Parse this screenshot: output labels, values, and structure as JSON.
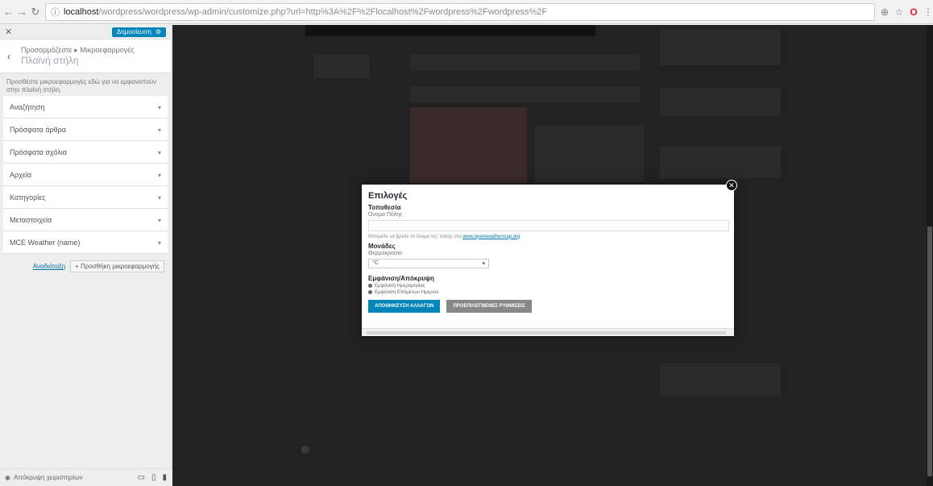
{
  "browser": {
    "url_host": "localhost",
    "url_path": "/wordpress/wordpress/wp-admin/customize.php?url=http%3A%2F%2Flocalhost%2Fwordpress%2Fwordpress%2F"
  },
  "sidebar": {
    "publish_label": "Δημοσίευση",
    "breadcrumb": "Προσαρμόζεστε ▸ Μικροεφαρμογές",
    "title": "Πλαϊνή στήλη",
    "description": "Προσθέστε μικροεφαρμογές εδώ για να εμφανιστούν στην πλαϊνή στήλη.",
    "widgets": [
      {
        "label": "Αναζήτηση"
      },
      {
        "label": "Πρόσφατα άρθρα"
      },
      {
        "label": "Πρόσφατα σχόλια"
      },
      {
        "label": "Αρχεία"
      },
      {
        "label": "Κατηγορίες"
      },
      {
        "label": "Μεταστοιχεία"
      },
      {
        "label": "MCE Weather (name)"
      }
    ],
    "reorder_label": "Αναδιάταξη",
    "add_widget_label": "+ Προσθήκη μικροεφαρμογής",
    "hide_controls_label": "Απόκρυψη χειριστηρίων"
  },
  "modal": {
    "title": "Επιλογές",
    "location_section": "Τοποθεσία",
    "location_field_label": "Όνομα Πόλης",
    "location_value": "",
    "help_text": "Μπορείτε να βρείτε το όνομα της πόλης στο",
    "help_link": "www.openweathermap.org",
    "units_section": "Μονάδες",
    "units_field_label": "Θερμοκρασία",
    "units_value": "°C",
    "display_section": "Εμφάνιση/Απόκρυψη",
    "display_options": [
      {
        "label": "Εμφάνιση Ημερομηνίας"
      },
      {
        "label": "Εμφάνιση Επόμενων Ημερών"
      }
    ],
    "save_label": "ΑΠΟΘΗΚΕΥΣΗ ΑΛΛΑΓΩΝ",
    "defaults_label": "ΠΡΟΕΠΙΛΕΓΜΕΝΕΣ ΡΥΘΜΙΣΕΙΣ"
  }
}
